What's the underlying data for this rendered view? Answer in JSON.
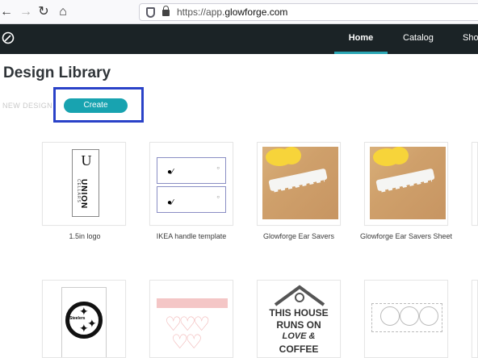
{
  "browser": {
    "url_prefix": "https://app.",
    "url_host": "glowforge.com"
  },
  "nav": {
    "items": [
      {
        "label": "Home",
        "active": true
      },
      {
        "label": "Catalog"
      },
      {
        "label": "Sho"
      }
    ]
  },
  "page": {
    "title": "Design Library",
    "new_design_label": "NEW DESIGN",
    "create_label": "Create"
  },
  "designs": [
    {
      "label": "1.5in logo",
      "thumb_text": {
        "mark": "U",
        "word": "UNION",
        "sub": "CELLARS"
      }
    },
    {
      "label": "IKEA handle template"
    },
    {
      "label": "Glowforge Ear Savers"
    },
    {
      "label": "Glowforge Ear Savers Sheet"
    },
    {
      "label": "",
      "thumb_text": {
        "badge": "Steelers"
      }
    },
    {
      "label": ""
    },
    {
      "label": "",
      "thumb_text": {
        "line1": "THIS HOUSE",
        "line2": "RUNS ON",
        "line3": "LOVE &",
        "line4": "COFFEE"
      }
    },
    {
      "label": ""
    }
  ],
  "colors": {
    "nav_bg": "#1b2326",
    "accent": "#18a3b0",
    "highlight": "#2a42c8"
  }
}
